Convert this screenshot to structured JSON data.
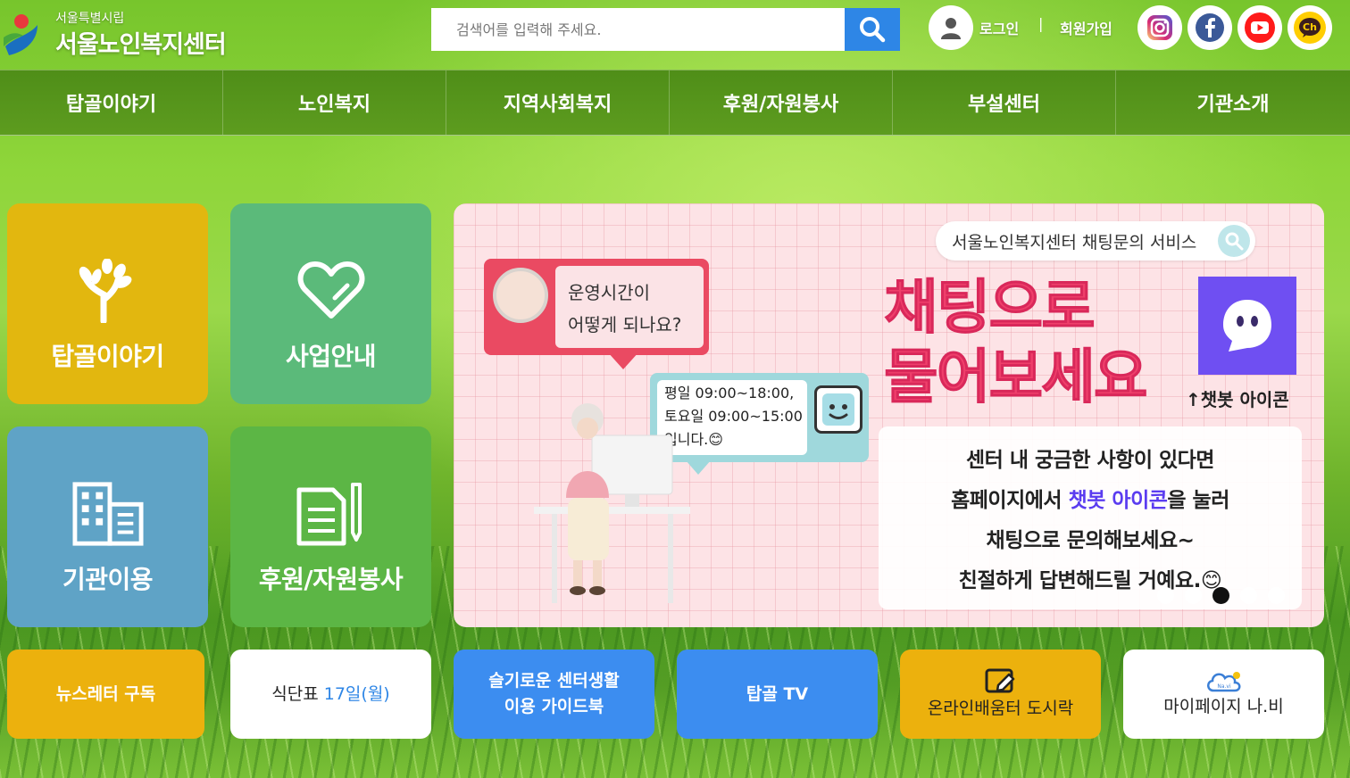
{
  "header": {
    "logo_sub": "서울특별시립",
    "logo_main": "서울노인복지센터",
    "search_placeholder": "검색어를 입력해 주세요.",
    "login_label": "로그인",
    "separator": "|",
    "signup_label": "회원가입",
    "social": [
      {
        "name": "instagram-icon",
        "color": "#e1306c"
      },
      {
        "name": "facebook-icon",
        "color": "#1877f2"
      },
      {
        "name": "youtube-icon",
        "color": "#ff0000"
      },
      {
        "name": "kakao-channel-icon",
        "color": "#ffcd00",
        "glyph": "Ch"
      }
    ]
  },
  "nav": {
    "items": [
      "탑골이야기",
      "노인복지",
      "지역사회복지",
      "후원/자원봉사",
      "부설센터",
      "기관소개"
    ]
  },
  "tiles": [
    {
      "label": "탑골이야기",
      "icon": "tree-icon",
      "color": "#e6b70e"
    },
    {
      "label": "사업안내",
      "icon": "heart-icon",
      "color": "#5cb87a"
    },
    {
      "label": "기관이용",
      "icon": "building-icon",
      "color": "#5aa0c8"
    },
    {
      "label": "후원/자원봉사",
      "icon": "document-pen-icon",
      "color": "#5bb544"
    }
  ],
  "banner": {
    "pill_text": "서울노인복지센터 채팅문의 서비스",
    "headline_1": "채팅으로",
    "headline_2": "물어보세요",
    "bot_label": "↑챗봇 아이콘",
    "question_1": "운영시간이",
    "question_2": "어떻게 되나요?",
    "answer_1": "평일 09:00~18:00,",
    "answer_2": "토요일 09:00~15:00",
    "answer_3": "입니다.😊",
    "card_line_1": "센터 내 궁금한 사항이 있다면",
    "card_line_2a": "홈페이지에서 ",
    "card_line_2b": "챗봇 아이콘",
    "card_line_2c": "을 눌러",
    "card_line_3": "채팅으로 문의해보세요~",
    "card_line_4": "친절하게 답변해드릴 거예요.😊",
    "slides_total": 5,
    "slide_active": 3
  },
  "quick": {
    "newsletter": "뉴스레터 구독",
    "menu_prefix": "식단표 ",
    "menu_date": "17일(월)",
    "guide_1": "슬기로운 센터생활",
    "guide_2": "이용 가이드북",
    "tv": "탑골 TV",
    "lunchbox": "온라인배움터 도시락",
    "mypage": "마이페이지 나.비",
    "mypage_icon_text": "Na.vi"
  }
}
